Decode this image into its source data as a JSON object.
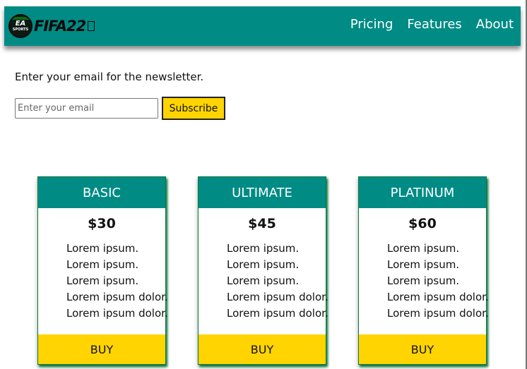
{
  "header": {
    "logo_badge": "EA",
    "logo_badge_sub": "SPORTS",
    "logo_text": "FIFA22",
    "nav": [
      "Pricing",
      "Features",
      "About"
    ]
  },
  "newsletter": {
    "prompt": "Enter your email for the newsletter.",
    "placeholder": "Enter your email",
    "button": "Subscribe"
  },
  "plans": [
    {
      "name": "BASIC",
      "price": "$30",
      "features": [
        "Lorem ipsum.",
        "Lorem ipsum.",
        "Lorem ipsum.",
        "Lorem ipsum dolor.",
        "Lorem ipsum dolor."
      ],
      "cta": "BUY"
    },
    {
      "name": "ULTIMATE",
      "price": "$45",
      "features": [
        "Lorem ipsum.",
        "Lorem ipsum.",
        "Lorem ipsum.",
        "Lorem ipsum dolor.",
        "Lorem ipsum dolor."
      ],
      "cta": "BUY"
    },
    {
      "name": "PLATINUM",
      "price": "$60",
      "features": [
        "Lorem ipsum.",
        "Lorem ipsum.",
        "Lorem ipsum.",
        "Lorem ipsum dolor.",
        "Lorem ipsum dolor."
      ],
      "cta": "BUY"
    }
  ],
  "colors": {
    "teal": "#008b85",
    "yellow": "#ffd400",
    "green_shadow": "#0b7a3e"
  }
}
